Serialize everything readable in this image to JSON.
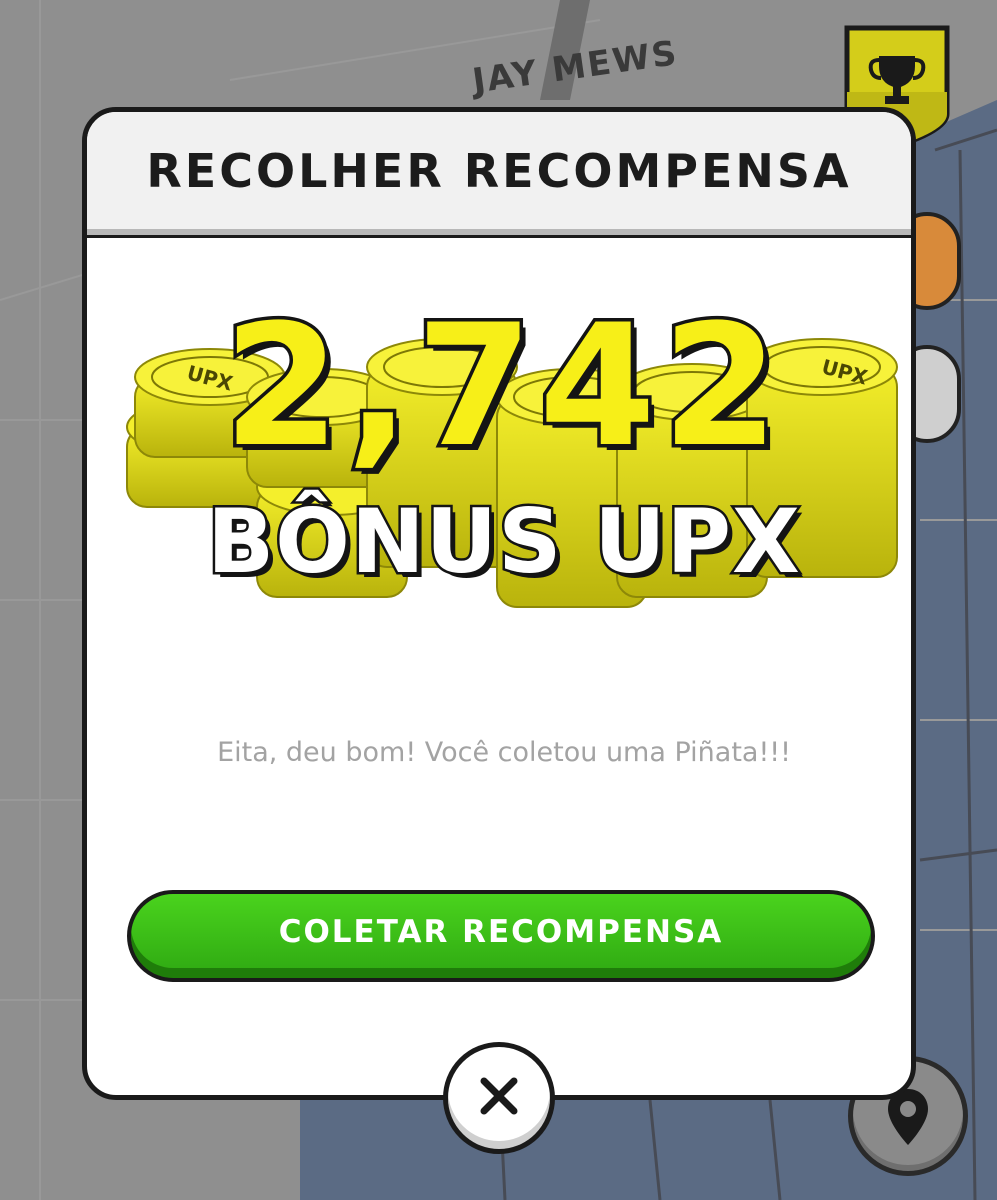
{
  "map": {
    "street_label": "JAY MEWS",
    "trophy_icon": "trophy-icon",
    "location_icon": "location-pin-icon"
  },
  "modal": {
    "title": "RECOLHER RECOMPENSA",
    "reward": {
      "amount": "2,742",
      "label": "BÔNUS UPX",
      "coin_text": "UPX"
    },
    "message": "Eita, deu bom! Você coletou uma Piñata!!!",
    "collect_button_label": "COLETAR RECOMPENSA",
    "close_icon": "close-icon"
  },
  "colors": {
    "coin_yellow": "#f7ef18",
    "button_green": "#3cc01a",
    "map_block_blue": "#5b6b84",
    "map_grey": "#8f8f8f"
  }
}
